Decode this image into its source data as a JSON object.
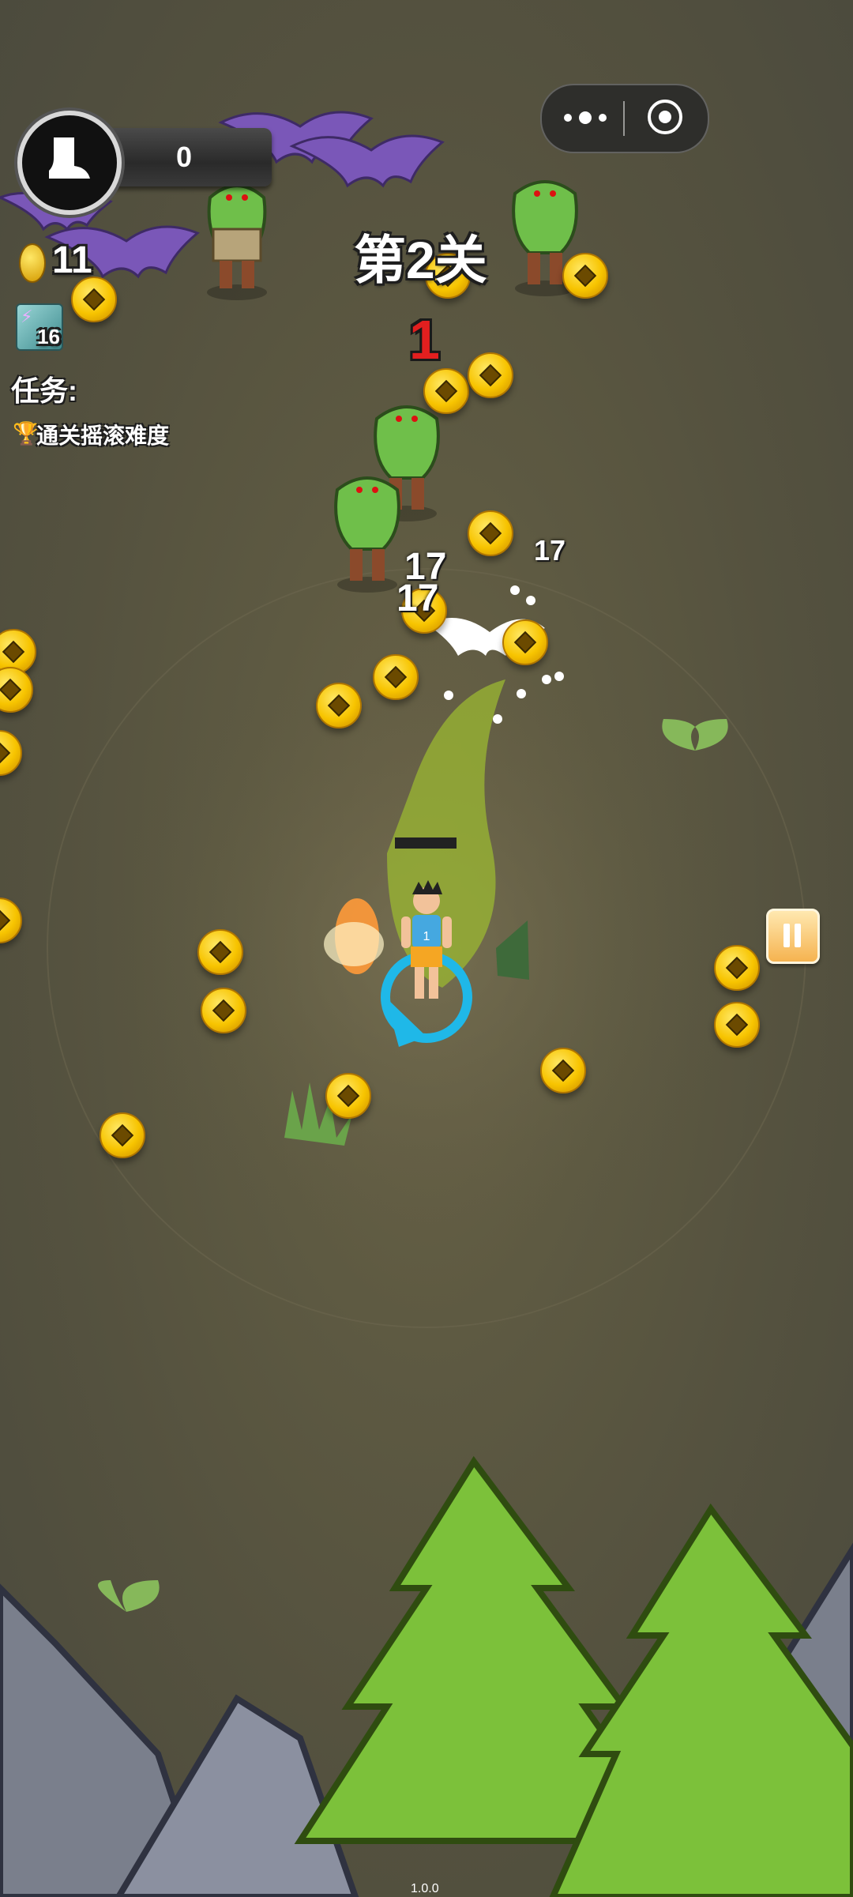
{
  "hud": {
    "score": "0",
    "coins": "11",
    "skill_level": "16",
    "task_label": "任务:",
    "task_item": "通关摇滚难度"
  },
  "level": {
    "title": "第2关"
  },
  "combo": "1",
  "damage_numbers": [
    "17",
    "17",
    "17"
  ],
  "version": "1.0.0",
  "menu_capsule": {
    "more_icon": "more-dots-icon",
    "close_icon": "target-circle-icon"
  },
  "colors": {
    "ground": "#5e5a42",
    "tree": "#7cc13a",
    "rock": "#7a7f8c",
    "combo_red": "#e21f1f",
    "coin": "#f7c400",
    "ring": "#1fb8e8"
  }
}
